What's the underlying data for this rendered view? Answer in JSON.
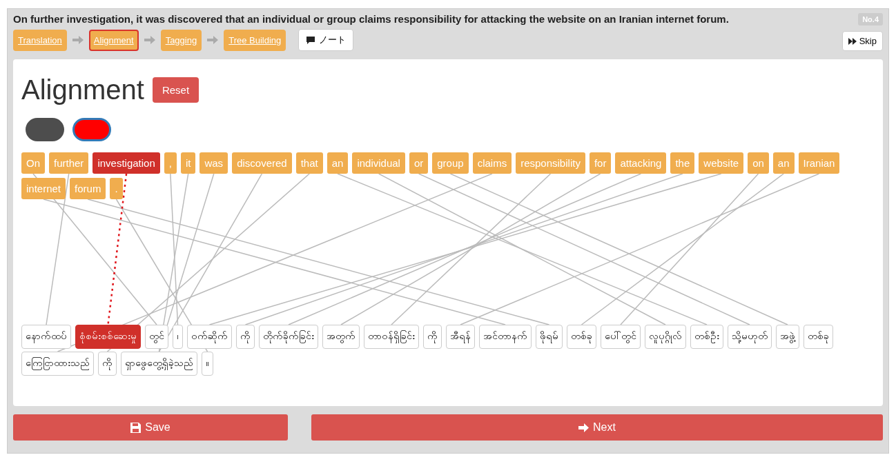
{
  "sentence": "On further investigation, it was discovered that an individual or group claims responsibility for attacking the website on an Iranian internet forum.",
  "badge": "No.4",
  "steps": [
    {
      "label": "Translation",
      "selected": false
    },
    {
      "label": "Alignment",
      "selected": true
    },
    {
      "label": "Tagging",
      "selected": false
    },
    {
      "label": "Tree Building",
      "selected": false
    }
  ],
  "note_button": "ノート",
  "skip_button": "Skip",
  "heading": "Alignment",
  "reset_button": "Reset",
  "toggles": [
    {
      "color": "#4d4d4d",
      "selected": false
    },
    {
      "color": "#ff0000",
      "selected": true
    }
  ],
  "source_tokens": [
    {
      "text": "On",
      "selected": false
    },
    {
      "text": "further",
      "selected": false
    },
    {
      "text": "investigation",
      "selected": true
    },
    {
      "text": ",",
      "selected": false
    },
    {
      "text": "it",
      "selected": false
    },
    {
      "text": "was",
      "selected": false
    },
    {
      "text": "discovered",
      "selected": false
    },
    {
      "text": "that",
      "selected": false
    },
    {
      "text": "an",
      "selected": false
    },
    {
      "text": "individual",
      "selected": false
    },
    {
      "text": "or",
      "selected": false
    },
    {
      "text": "group",
      "selected": false
    },
    {
      "text": "claims",
      "selected": false
    },
    {
      "text": "responsibility",
      "selected": false
    },
    {
      "text": "for",
      "selected": false
    },
    {
      "text": "attacking",
      "selected": false
    },
    {
      "text": "the",
      "selected": false
    },
    {
      "text": "website",
      "selected": false
    },
    {
      "text": "on",
      "selected": false
    },
    {
      "text": "an",
      "selected": false
    },
    {
      "text": "Iranian",
      "selected": false
    },
    {
      "text": "internet",
      "selected": false
    },
    {
      "text": "forum",
      "selected": false
    },
    {
      "text": ".",
      "selected": false
    }
  ],
  "target_tokens": [
    {
      "text": "နောက်ထပ်",
      "selected": false
    },
    {
      "text": "စုံစမ်းစစ်ဆေးမှု",
      "selected": true
    },
    {
      "text": "တွင်",
      "selected": false
    },
    {
      "text": "၊",
      "selected": false
    },
    {
      "text": "ဝက်ဆိုက်",
      "selected": false
    },
    {
      "text": "ကို",
      "selected": false
    },
    {
      "text": "တိုက်ခိုက်ခြင်း",
      "selected": false
    },
    {
      "text": "အတွက်",
      "selected": false
    },
    {
      "text": "တာဝန်ရှိခြင်း",
      "selected": false
    },
    {
      "text": "ကို",
      "selected": false
    },
    {
      "text": "အီရန်",
      "selected": false
    },
    {
      "text": "အင်တာနက်",
      "selected": false
    },
    {
      "text": "ဖိုရမ်",
      "selected": false
    },
    {
      "text": "တစ်ခု",
      "selected": false
    },
    {
      "text": "ပေါ်တွင်",
      "selected": false
    },
    {
      "text": "လူပုဂ္ဂိုလ်",
      "selected": false
    },
    {
      "text": "တစ်ဦး",
      "selected": false
    },
    {
      "text": "သို့မဟုတ်",
      "selected": false
    },
    {
      "text": "အဖွဲ့",
      "selected": false
    },
    {
      "text": "တစ်ခု",
      "selected": false
    },
    {
      "text": "ကြေငြာထားသည်",
      "selected": false
    },
    {
      "text": "ကို",
      "selected": false
    },
    {
      "text": "ရှာဖွေတွေ့ရှိခဲ့သည်",
      "selected": false
    },
    {
      "text": "။",
      "selected": false
    }
  ],
  "save_button": "Save",
  "next_button": "Next"
}
